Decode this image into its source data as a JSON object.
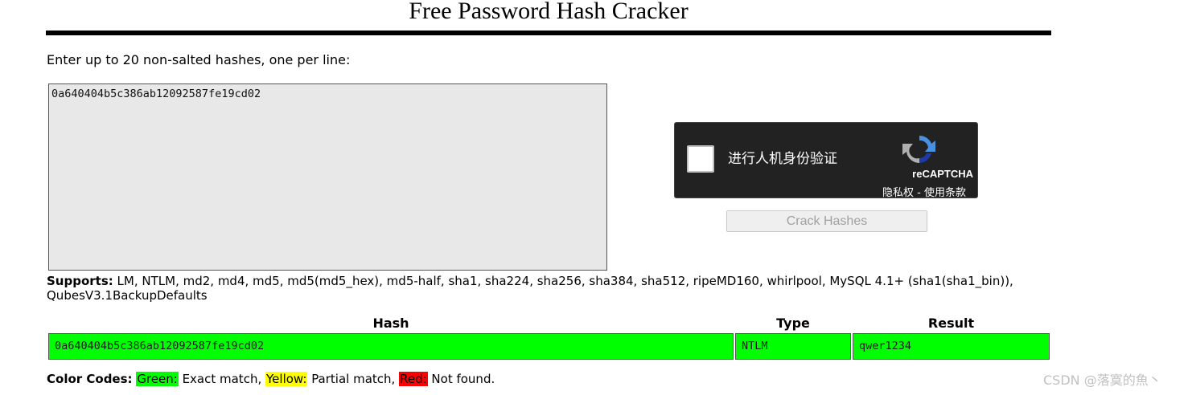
{
  "page": {
    "title": "Free Password Hash Cracker",
    "instructions": "Enter up to 20 non-salted hashes, one per line:"
  },
  "hash_input": {
    "value": "0a640404b5c386ab12092587fe19cd02"
  },
  "captcha": {
    "label": "进行人机身份验证",
    "brand": "reCAPTCHA",
    "privacy_link": "隐私权",
    "separator": " - ",
    "terms_link": "使用条款"
  },
  "crack_button": {
    "label": "Crack Hashes"
  },
  "supports": {
    "label": "Supports:",
    "text": "LM, NTLM, md2, md4, md5, md5(md5_hex), md5-half, sha1, sha224, sha256, sha384, sha512, ripeMD160, whirlpool, MySQL 4.1+ (sha1(sha1_bin)), QubesV3.1BackupDefaults"
  },
  "results_table": {
    "headers": [
      "Hash",
      "Type",
      "Result"
    ],
    "rows": [
      {
        "hash": "0a640404b5c386ab12092587fe19cd02",
        "type": "NTLM",
        "result": "qwer1234",
        "status": "exact-match"
      }
    ]
  },
  "color_codes": {
    "label": "Color Codes:",
    "green": {
      "swatch": "Green:",
      "text": " Exact match,",
      "color": "#00ff00"
    },
    "yellow": {
      "swatch": "Yellow:",
      "text": " Partial match,",
      "color": "#ffff00"
    },
    "red": {
      "swatch": "Red:",
      "text": " Not found.",
      "color": "#ff0000"
    }
  },
  "watermark": {
    "text": "CSDN @落寞的魚丶"
  },
  "colors": {
    "exact_match": "#00ff00",
    "captcha_bg": "#222222",
    "textarea_bg": "#e8e8e8"
  }
}
